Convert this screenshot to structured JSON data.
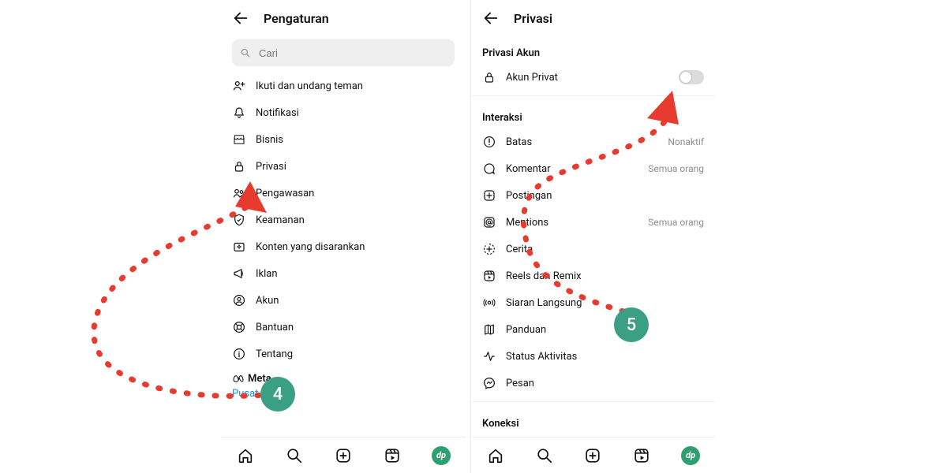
{
  "annotations": {
    "badge_left": "4",
    "badge_right": "5",
    "color": "#3a9f85",
    "stroke": "#e73b2f"
  },
  "left": {
    "title": "Pengaturan",
    "search_placeholder": "Cari",
    "items": [
      {
        "icon": "user-plus-icon",
        "label": "Ikuti dan undang teman"
      },
      {
        "icon": "bell-icon",
        "label": "Notifikasi"
      },
      {
        "icon": "shop-icon",
        "label": "Bisnis"
      },
      {
        "icon": "lock-icon",
        "label": "Privasi"
      },
      {
        "icon": "people-icon",
        "label": "Pengawasan"
      },
      {
        "icon": "shield-icon",
        "label": "Keamanan"
      },
      {
        "icon": "sparkle-icon",
        "label": "Konten yang disarankan"
      },
      {
        "icon": "megaphone-icon",
        "label": "Iklan"
      },
      {
        "icon": "user-circle-icon",
        "label": "Akun"
      },
      {
        "icon": "lifebuoy-icon",
        "label": "Bantuan"
      },
      {
        "icon": "info-icon",
        "label": "Tentang"
      }
    ],
    "meta_brand": "Meta",
    "meta_link": "Pusat Akun"
  },
  "right": {
    "title": "Privasi",
    "section_account": "Privasi Akun",
    "account_toggle_label": "Akun Privat",
    "account_toggle_on": false,
    "section_interactions": "Interaksi",
    "items": [
      {
        "icon": "limit-icon",
        "label": "Batas",
        "trail": "Nonaktif"
      },
      {
        "icon": "comment-icon",
        "label": "Komentar",
        "trail": "Semua orang"
      },
      {
        "icon": "plus-box-icon",
        "label": "Postingan",
        "trail": ""
      },
      {
        "icon": "mention-icon",
        "label": "Mentions",
        "trail": "Semua orang"
      },
      {
        "icon": "story-plus-icon",
        "label": "Cerita",
        "trail": ""
      },
      {
        "icon": "reels-icon",
        "label": "Reels dan Remix",
        "trail": ""
      },
      {
        "icon": "live-icon",
        "label": "Siaran Langsung",
        "trail": ""
      },
      {
        "icon": "map-icon",
        "label": "Panduan",
        "trail": ""
      },
      {
        "icon": "activity-icon",
        "label": "Status Aktivitas",
        "trail": ""
      },
      {
        "icon": "messenger-icon",
        "label": "Pesan",
        "trail": ""
      }
    ],
    "section_connections": "Koneksi"
  },
  "nav": {
    "items": [
      "home-icon",
      "search-icon",
      "add-icon",
      "reels-icon",
      "profile-avatar"
    ]
  }
}
